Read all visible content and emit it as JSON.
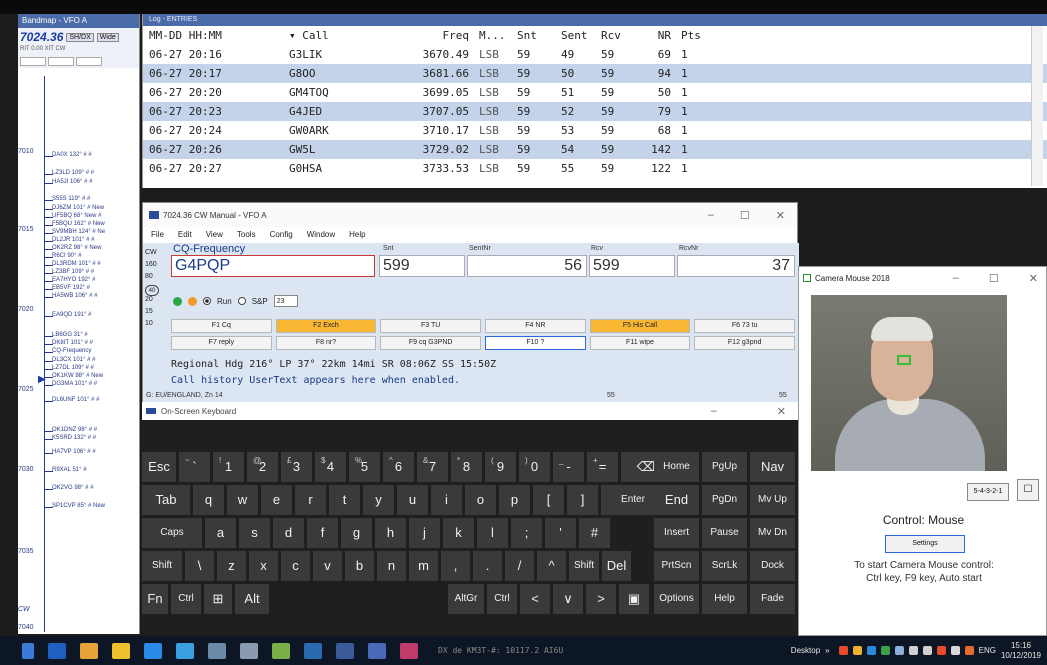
{
  "bandmap": {
    "title": "Bandmap - VFO A",
    "freq": "7024.36",
    "btn_sh": "SH/DX",
    "btn_wide": "Wide",
    "sub": "RIT  0.00  XIT  CW",
    "mhz": [
      "7010",
      "7015",
      "7020",
      "7025",
      "7030",
      "7035",
      "7040"
    ],
    "spots": [
      "DA0X 132° # #",
      "LZ3LD 109° # #",
      "HA5JI 106° # #",
      "S55S 119° # #",
      "DJ6ZM 101° # New",
      "UF5BQ 68° New #",
      "F5BQU 162° # New",
      "SV9MBH 124° # Ne",
      "DL2JR 101° # #",
      "OK2RZ 98° # New",
      "R6CI 90° #",
      "DL3RDM 101° # #",
      "LZ3BF 109° # #",
      "EA7HYO 192° #",
      "EB5VF 192° #",
      "HA5WB 106° # #",
      "EA9QD 191° #",
      "LB6GG 31° #",
      "DK8IT 101° # #",
      "CQ-Frequency",
      "DL3CX 101° # #",
      "LZ7DL 109° # #",
      "OK1KW 98° # New",
      "DG3MA 101° # #",
      "DL6UNF 101° # #",
      "OK1DNZ 98° # #",
      "K5SRD 132° # #",
      "HA7VP 106° # #",
      "R9XAL 51° #",
      "OK2VG 98° # #",
      "SP1CVP 85° # New"
    ],
    "bottom": "CW"
  },
  "log": {
    "title": "Log - ENTRIES",
    "headers": [
      "MM-DD HH:MM",
      "Call",
      "Freq",
      "M...",
      "Snt",
      "Sent",
      "Rcv",
      "NR",
      "Pts"
    ],
    "rows": [
      [
        "06-27 20:16",
        "G3LIK",
        "3670.49",
        "LSB",
        "59",
        "49",
        "59",
        "69",
        "1"
      ],
      [
        "06-27 20:17",
        "G8OO",
        "3681.66",
        "LSB",
        "59",
        "50",
        "59",
        "94",
        "1"
      ],
      [
        "06-27 20:20",
        "GM4TOQ",
        "3699.05",
        "LSB",
        "59",
        "51",
        "59",
        "50",
        "1"
      ],
      [
        "06-27 20:23",
        "G4JED",
        "3707.05",
        "LSB",
        "59",
        "52",
        "59",
        "79",
        "1"
      ],
      [
        "06-27 20:24",
        "GW0ARK",
        "3710.17",
        "LSB",
        "59",
        "53",
        "59",
        "68",
        "1"
      ],
      [
        "06-27 20:26",
        "GW5L",
        "3729.02",
        "LSB",
        "59",
        "54",
        "59",
        "142",
        "1"
      ],
      [
        "06-27 20:27",
        "G0HSA",
        "3733.53",
        "LSB",
        "59",
        "55",
        "59",
        "122",
        "1"
      ]
    ]
  },
  "cw": {
    "title": "7024.36 CW Manual - VFO A",
    "menu": [
      "File",
      "Edit",
      "View",
      "Tools",
      "Config",
      "Window",
      "Help"
    ],
    "mode_col": [
      "CW",
      "160",
      "80",
      "40",
      "20",
      "15",
      "10"
    ],
    "field_label_call": "CQ-Frequency",
    "field_label_snt": "Snt",
    "field_label_sentnr": "SentNr",
    "field_label_rcv": "Rcv",
    "field_label_rcvnr": "RcvNr",
    "call_value": "G4PQP",
    "snt_value": "599",
    "sentnr_value": "56",
    "rcv_value": "599",
    "rcvnr_value": "37",
    "run_label": "Run",
    "sp_label": "S&P",
    "spin_value": "23",
    "fkeys": [
      "F1 Cq",
      "F2 Exch",
      "F3 TU",
      "F4 NR",
      "F5 His Call",
      "F6 73 tu",
      "F7 reply",
      "F8 nr?",
      "F9 cq G3PND",
      "F10 ?",
      "F11 wipe",
      "F12 g3pnd"
    ],
    "info1": "Regional Hdg 216° LP 37° 22km 14mi SR 08:06Z SS 15:50Z",
    "info2": "Call history UserText appears here when enabled.",
    "status_left": "G: EU/ENGLAND, Zn 14",
    "status_mid": "55",
    "status_right": "55"
  },
  "osk": {
    "title": "On-Screen Keyboard",
    "row1": [
      [
        "Esc",
        ""
      ],
      [
        "`",
        "~"
      ],
      [
        "1",
        "!"
      ],
      [
        "2",
        "@"
      ],
      [
        "3",
        "£"
      ],
      [
        "4",
        "$"
      ],
      [
        "5",
        "%"
      ],
      [
        "6",
        "^"
      ],
      [
        "7",
        "&"
      ],
      [
        "8",
        "*"
      ],
      [
        "9",
        "("
      ],
      [
        "0",
        ")"
      ],
      [
        "-",
        "_"
      ],
      [
        "=",
        "+"
      ],
      [
        "⌫",
        ""
      ]
    ],
    "row2": [
      "Tab",
      "q",
      "w",
      "e",
      "r",
      "t",
      "y",
      "u",
      "i",
      "o",
      "p",
      "[",
      "]",
      "Enter"
    ],
    "row3": [
      "Caps",
      "a",
      "s",
      "d",
      "f",
      "g",
      "h",
      "j",
      "k",
      "l",
      ";",
      "'",
      "#"
    ],
    "row4": [
      "Shift",
      "\\",
      "z",
      "x",
      "c",
      "v",
      "b",
      "n",
      "m",
      ",",
      ".",
      "/",
      "^",
      "Shift",
      "Del"
    ],
    "row5": [
      "Fn",
      "Ctrl",
      "⊞",
      "Alt",
      "AltGr",
      "Ctrl",
      "<",
      "∨",
      ">",
      "▣"
    ],
    "nav": [
      "Home",
      "PgUp",
      "Nav",
      "End",
      "PgDn",
      "Mv Up",
      "Insert",
      "Pause",
      "Mv Dn",
      "PrtScn",
      "ScrLk",
      "Dock",
      "Options",
      "Help",
      "Fade"
    ]
  },
  "cam": {
    "title": "Camera Mouse 2018",
    "btn_ratio": "5-4-3-2-1",
    "control": "Control: Mouse",
    "settings": "Settings",
    "help1": "To start Camera Mouse control:",
    "help2": "Ctrl key, F9 key, Auto start"
  },
  "taskbar": {
    "desktop": "Desktop",
    "lang": "ENG",
    "time": "15:16",
    "date": "10/12/2019",
    "dx_line": "DX de KM3T-#:   10117.2  AI6U"
  },
  "colors": {
    "row_alt": "#c4d3ea",
    "accent": "#f7b733",
    "title_blue": "#4a6aa8"
  }
}
